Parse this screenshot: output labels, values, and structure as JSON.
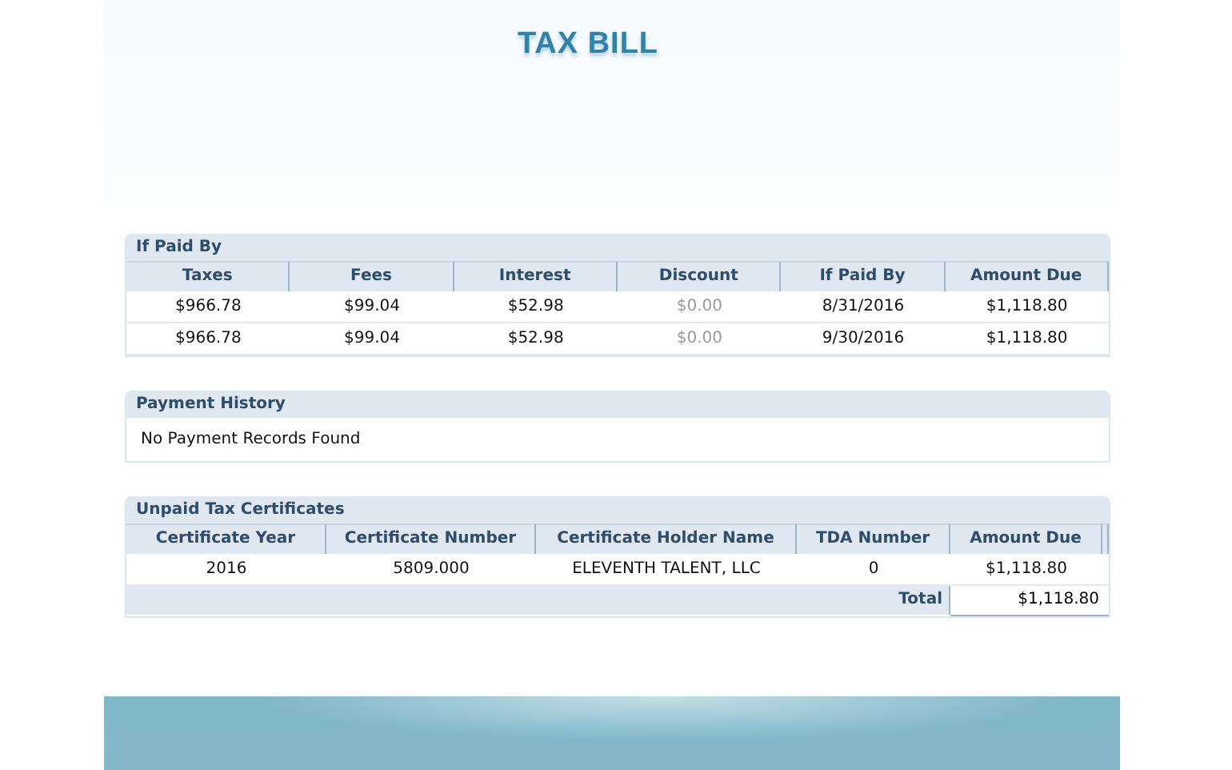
{
  "title": "TAX BILL",
  "if_paid_by": {
    "heading": "If Paid By",
    "columns": [
      {
        "label": "Taxes",
        "dimmed": false
      },
      {
        "label": "Fees",
        "dimmed": false
      },
      {
        "label": "Interest",
        "dimmed": false
      },
      {
        "label": "Discount",
        "dimmed": true
      },
      {
        "label": "If Paid By",
        "dimmed": false
      },
      {
        "label": "Amount Due",
        "dimmed": false
      }
    ],
    "rows": [
      [
        "$966.78",
        "$99.04",
        "$52.98",
        "$0.00",
        "8/31/2016",
        "$1,118.80"
      ],
      [
        "$966.78",
        "$99.04",
        "$52.98",
        "$0.00",
        "9/30/2016",
        "$1,118.80"
      ]
    ]
  },
  "payment_history": {
    "heading": "Payment History",
    "message": "No Payment Records Found"
  },
  "unpaid_tax_certificates": {
    "heading": "Unpaid Tax Certificates",
    "columns": [
      "Certificate Year",
      "Certificate Number",
      "Certificate Holder Name",
      "TDA Number",
      "Amount Due"
    ],
    "rows": [
      [
        "2016",
        "5809.000",
        "ELEVENTH TALENT, LLC",
        "0",
        "$1,118.80"
      ]
    ],
    "total": {
      "label": "Total",
      "value": "$1,118.80"
    }
  }
}
